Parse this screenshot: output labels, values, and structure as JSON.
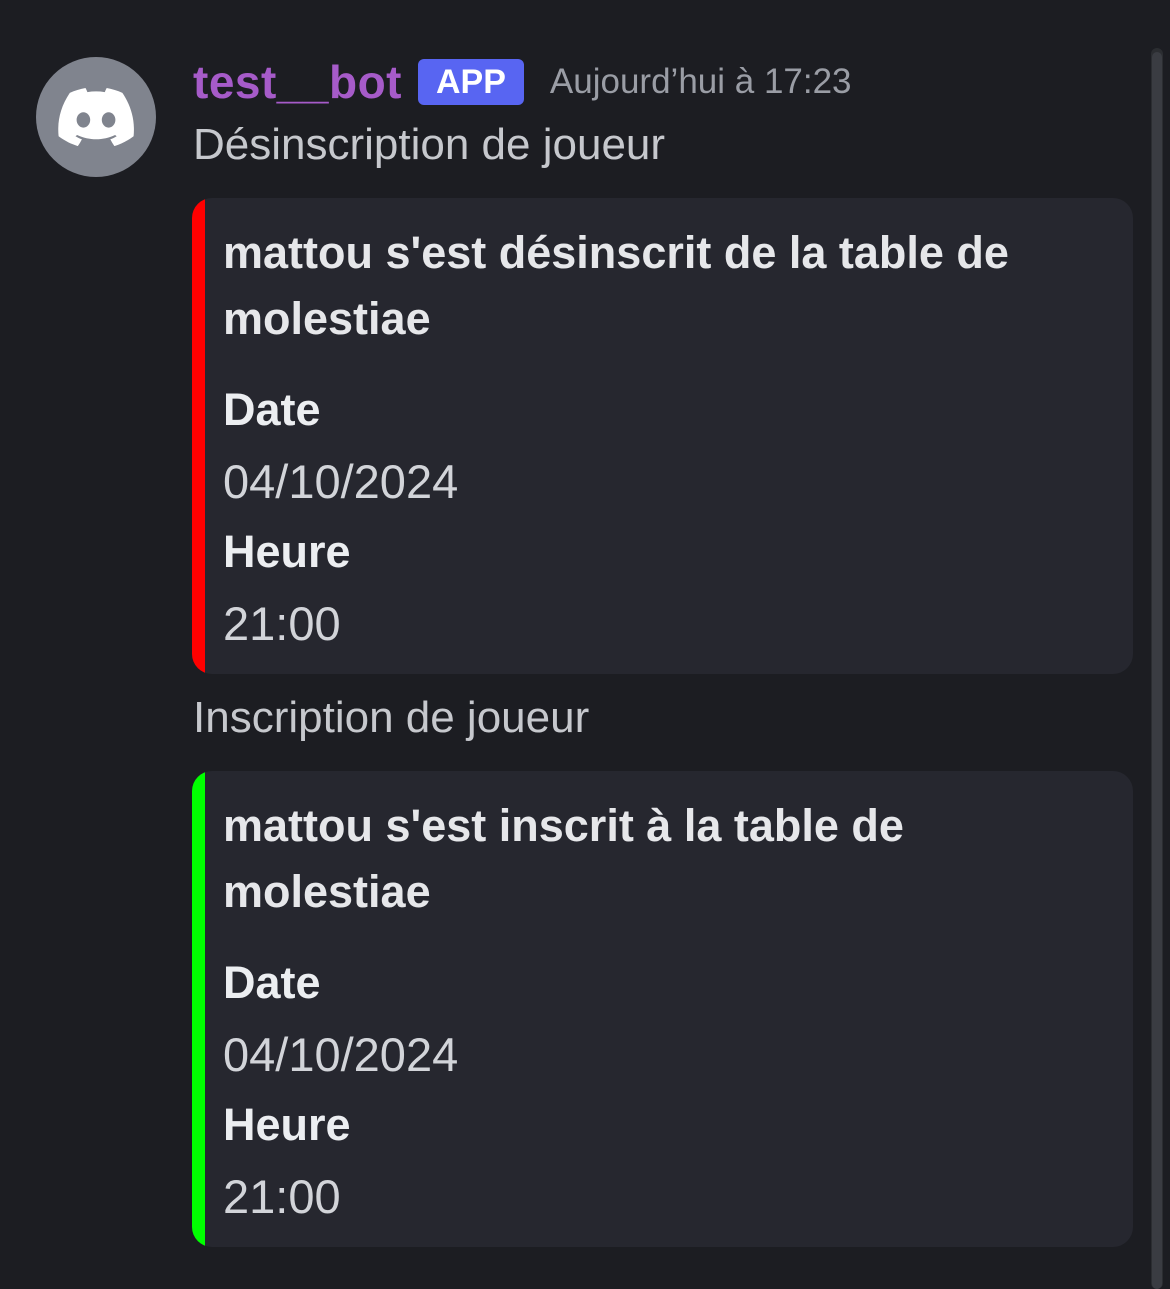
{
  "author": {
    "name": "test__bot",
    "badge": "APP",
    "timestamp": "Aujourd’hui à 17:23",
    "avatar_icon": "discord-logo-icon"
  },
  "messages": [
    {
      "content": "Désinscription de joueur",
      "embed": {
        "color": "#ff0000",
        "description": "mattou s'est désinscrit de la table de molestiae",
        "fields": [
          {
            "name": "Date",
            "value": "04/10/2024"
          },
          {
            "name": "Heure",
            "value": "21:00"
          }
        ]
      }
    },
    {
      "content": "Inscription de joueur",
      "embed": {
        "color": "#00ff00",
        "description": "mattou s'est inscrit à la table de molestiae",
        "fields": [
          {
            "name": "Date",
            "value": "04/10/2024"
          },
          {
            "name": "Heure",
            "value": "21:00"
          }
        ]
      }
    }
  ],
  "theme": {
    "background": "#1c1d22",
    "embed_background": "#26272f",
    "username_color": "#a65bc9",
    "badge_color": "#5865f2"
  }
}
